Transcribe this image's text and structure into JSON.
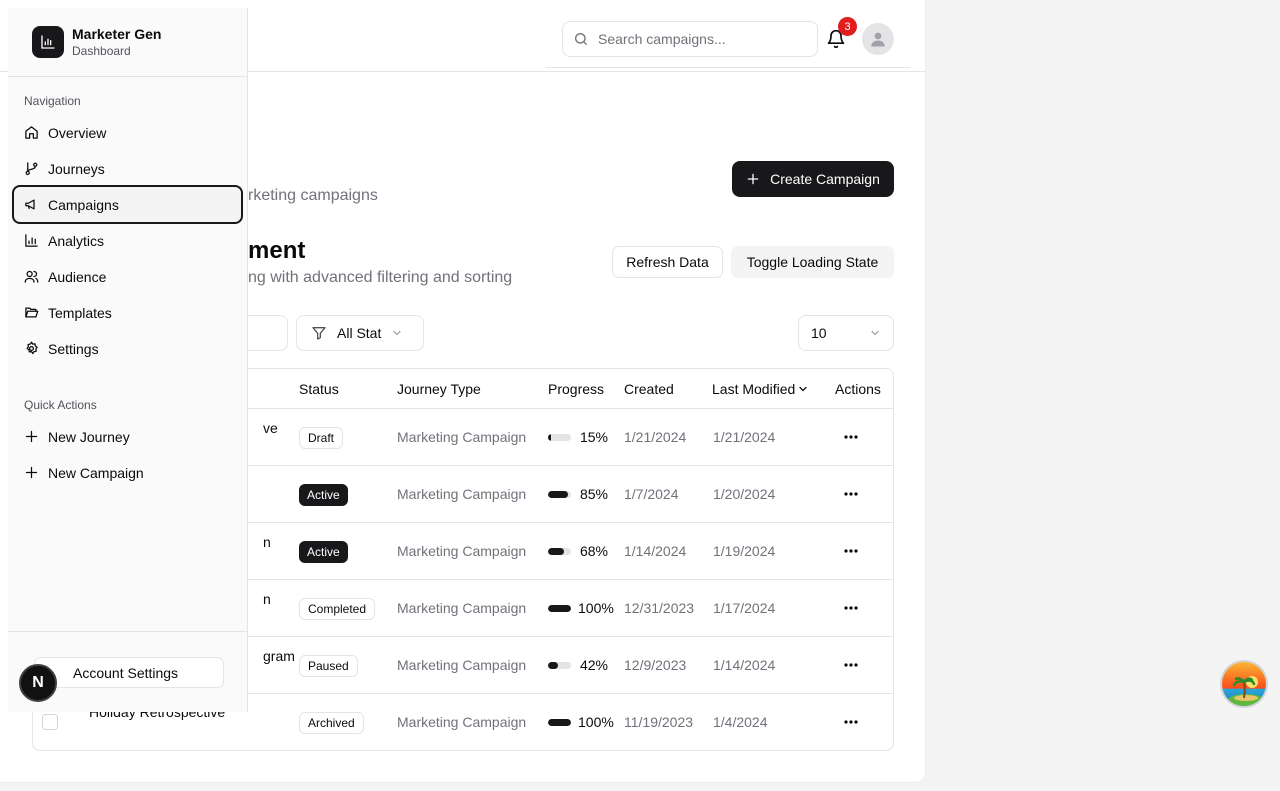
{
  "header": {
    "search_placeholder": "Search campaigns...",
    "notification_count": "3"
  },
  "page": {
    "subtitle_fragment": "rketing campaigns",
    "create_button": "Create Campaign"
  },
  "section": {
    "title_fragment": "ment",
    "subtitle_fragment": "ng with advanced filtering and sorting",
    "refresh_button": "Refresh Data",
    "toggle_button": "Toggle Loading State"
  },
  "filters": {
    "status_value": "All Stat",
    "page_size_value": "10"
  },
  "table": {
    "headers": {
      "status": "Status",
      "journey_type": "Journey Type",
      "progress": "Progress",
      "created": "Created",
      "last_modified": "Last Modified",
      "actions": "Actions"
    },
    "rows": [
      {
        "name": "ve",
        "status": "Draft",
        "status_style": "outline",
        "journey_type": "Marketing Campaign",
        "progress": 15,
        "progress_label": "15%",
        "created": "1/21/2024",
        "modified": "1/21/2024"
      },
      {
        "name": "",
        "status": "Active",
        "status_style": "filled",
        "journey_type": "Marketing Campaign",
        "progress": 85,
        "progress_label": "85%",
        "created": "1/7/2024",
        "modified": "1/20/2024"
      },
      {
        "name": "n",
        "status": "Active",
        "status_style": "filled",
        "journey_type": "Marketing Campaign",
        "progress": 68,
        "progress_label": "68%",
        "created": "1/14/2024",
        "modified": "1/19/2024"
      },
      {
        "name": "n",
        "status": "Completed",
        "status_style": "outline",
        "journey_type": "Marketing Campaign",
        "progress": 100,
        "progress_label": "100%",
        "created": "12/31/2023",
        "modified": "1/17/2024"
      },
      {
        "name": "gram",
        "status": "Paused",
        "status_style": "outline",
        "journey_type": "Marketing Campaign",
        "progress": 42,
        "progress_label": "42%",
        "created": "12/9/2023",
        "modified": "1/14/2024"
      },
      {
        "name": "Holiday Retrospective",
        "status": "Archived",
        "status_style": "outline",
        "journey_type": "Marketing Campaign",
        "progress": 100,
        "progress_label": "100%",
        "created": "11/19/2023",
        "modified": "1/4/2024"
      }
    ]
  },
  "sidebar": {
    "app_name": "Marketer Gen",
    "app_sub": "Dashboard",
    "nav_label": "Navigation",
    "items": [
      {
        "label": "Overview",
        "icon": "home-icon"
      },
      {
        "label": "Journeys",
        "icon": "git-branch-icon"
      },
      {
        "label": "Campaigns",
        "icon": "megaphone-icon",
        "active": true
      },
      {
        "label": "Analytics",
        "icon": "bar-chart-icon"
      },
      {
        "label": "Audience",
        "icon": "users-icon"
      },
      {
        "label": "Templates",
        "icon": "folder-open-icon"
      },
      {
        "label": "Settings",
        "icon": "gear-icon"
      }
    ],
    "quick_label": "Quick Actions",
    "quick_items": [
      {
        "label": "New Journey",
        "icon": "plus-icon"
      },
      {
        "label": "New Campaign",
        "icon": "plus-icon"
      }
    ],
    "account_button": "Account Settings"
  },
  "dev_badge": "N",
  "colors": {
    "primary": "#18181b",
    "muted_text": "#71717a",
    "border": "#e4e4e7",
    "notification": "#e11d1d"
  }
}
